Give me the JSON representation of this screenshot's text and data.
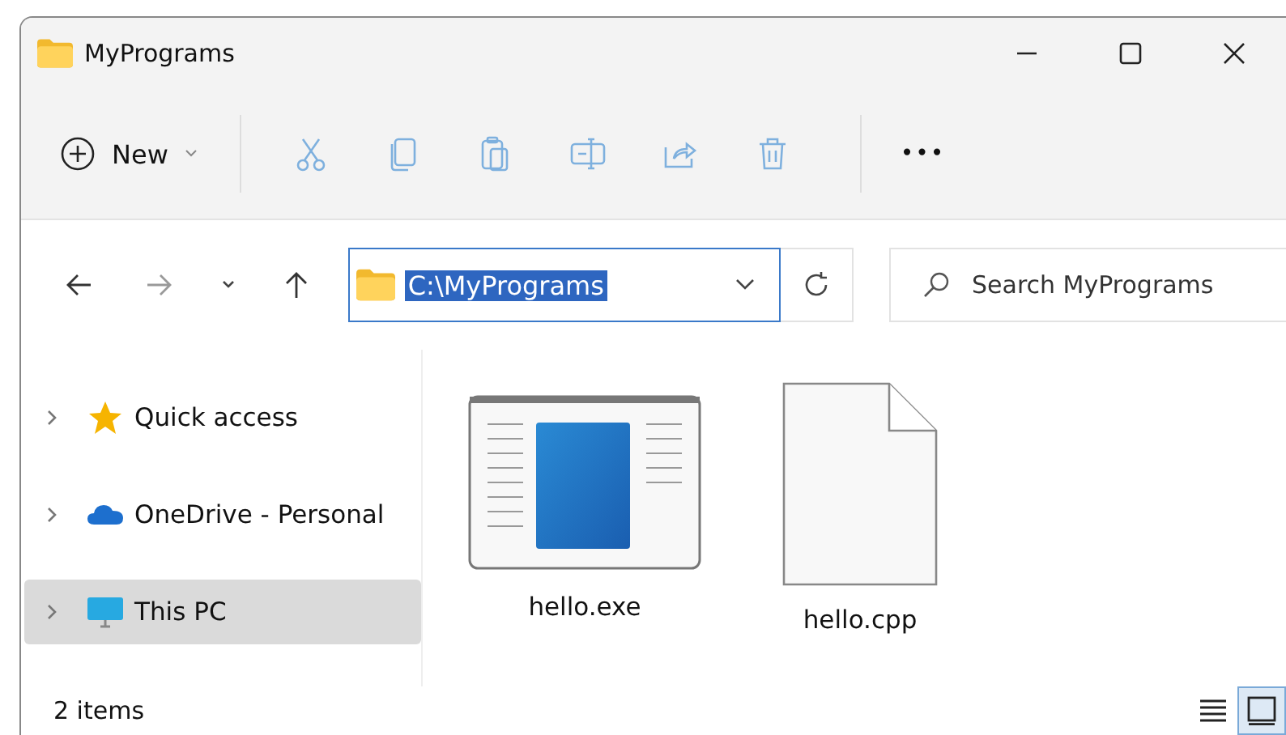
{
  "window": {
    "title": "MyPrograms"
  },
  "toolbar": {
    "new_button": {
      "label": "New"
    },
    "actions": [
      {
        "kind": "cut",
        "disabled": true
      },
      {
        "kind": "copy",
        "disabled": true
      },
      {
        "kind": "paste",
        "disabled": true
      },
      {
        "kind": "rename",
        "disabled": true
      },
      {
        "kind": "share",
        "disabled": true
      },
      {
        "kind": "delete",
        "disabled": true
      }
    ],
    "more": "•••"
  },
  "address_bar": {
    "value": "C:\\MyPrograms",
    "text_selected": true
  },
  "search": {
    "placeholder": "Search MyPrograms"
  },
  "sidebar": {
    "items": [
      {
        "label": "Quick access",
        "kind": "star",
        "selected": false
      },
      {
        "label": "OneDrive - Personal",
        "kind": "cloud",
        "selected": false
      },
      {
        "label": "This PC",
        "kind": "pc",
        "selected": true
      }
    ]
  },
  "files": [
    {
      "name": "hello.exe",
      "kind": "exe"
    },
    {
      "name": "hello.cpp",
      "kind": "document"
    }
  ],
  "status_bar": {
    "count": "2 items",
    "views": [
      {
        "kind": "details",
        "selected": false
      },
      {
        "kind": "tiles",
        "selected": true
      }
    ]
  }
}
